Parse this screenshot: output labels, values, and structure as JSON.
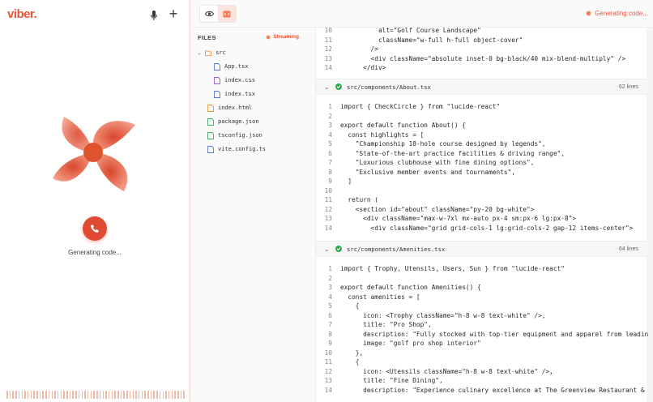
{
  "app": {
    "logo": "viber."
  },
  "left": {
    "status": "Generating code..."
  },
  "topbar": {
    "status": "Generating code..."
  },
  "files": {
    "heading": "FILES",
    "badge": "Streaming",
    "items": [
      {
        "name": "src",
        "kind": "folder"
      },
      {
        "name": "App.tsx",
        "kind": "tsx"
      },
      {
        "name": "index.css",
        "kind": "css"
      },
      {
        "name": "index.tsx",
        "kind": "tsx"
      },
      {
        "name": "index.html",
        "kind": "html"
      },
      {
        "name": "package.json",
        "kind": "json"
      },
      {
        "name": "tsconfig.json",
        "kind": "json"
      },
      {
        "name": "vite.config.ts",
        "kind": "ts"
      }
    ]
  },
  "code": {
    "top_lines": [
      {
        "n": "10",
        "t": "          alt=\"Golf Course Landscape\""
      },
      {
        "n": "11",
        "t": "          className=\"w-full h-full object-cover\""
      },
      {
        "n": "12",
        "t": "        />"
      },
      {
        "n": "13",
        "t": "        <div className=\"absolute inset-0 bg-black/40 mix-blend-multiply\" />"
      },
      {
        "n": "14",
        "t": "      </div>"
      }
    ],
    "about": {
      "path": "src/components/About.tsx",
      "count": "62 lines",
      "lines": [
        {
          "n": "1",
          "t": "import { CheckCircle } from \"lucide-react\""
        },
        {
          "n": "2",
          "t": ""
        },
        {
          "n": "3",
          "t": "export default function About() {"
        },
        {
          "n": "4",
          "t": "  const highlights = ["
        },
        {
          "n": "5",
          "t": "    \"Championship 18-hole course designed by legends\","
        },
        {
          "n": "6",
          "t": "    \"State-of-the-art practice facilities & driving range\","
        },
        {
          "n": "7",
          "t": "    \"Luxurious clubhouse with fine dining options\","
        },
        {
          "n": "8",
          "t": "    \"Exclusive member events and tournaments\","
        },
        {
          "n": "9",
          "t": "  ]"
        },
        {
          "n": "10",
          "t": ""
        },
        {
          "n": "11",
          "t": "  return ("
        },
        {
          "n": "12",
          "t": "    <section id=\"about\" className=\"py-20 bg-white\">"
        },
        {
          "n": "13",
          "t": "      <div className=\"max-w-7xl mx-auto px-4 sm:px-6 lg:px-8\">"
        },
        {
          "n": "14",
          "t": "        <div className=\"grid grid-cols-1 lg:grid-cols-2 gap-12 items-center\">"
        }
      ]
    },
    "amenities": {
      "path": "src/components/Amenities.tsx",
      "count": "64 lines",
      "lines": [
        {
          "n": "1",
          "t": "import { Trophy, Utensils, Users, Sun } from \"lucide-react\""
        },
        {
          "n": "2",
          "t": ""
        },
        {
          "n": "3",
          "t": "export default function Amenities() {"
        },
        {
          "n": "4",
          "t": "  const amenities = ["
        },
        {
          "n": "5",
          "t": "    {"
        },
        {
          "n": "6",
          "t": "      icon: <Trophy className=\"h-8 w-8 text-white\" />,"
        },
        {
          "n": "7",
          "t": "      title: \"Pro Shop\","
        },
        {
          "n": "8",
          "t": "      description: \"Fully stocked with top-tier equipment and apparel from leadin"
        },
        {
          "n": "9",
          "t": "      image: \"golf pro shop interior\""
        },
        {
          "n": "10",
          "t": "    },"
        },
        {
          "n": "11",
          "t": "    {"
        },
        {
          "n": "12",
          "t": "      icon: <Utensils className=\"h-8 w-8 text-white\" />,"
        },
        {
          "n": "13",
          "t": "      title: \"Fine Dining\","
        },
        {
          "n": "14",
          "t": "      description: \"Experience culinary excellence at The Greenview Restaurant &"
        }
      ]
    }
  },
  "colors": {
    "accent": "#e8553a",
    "call": "#e14a32",
    "success": "#2fa84f"
  }
}
